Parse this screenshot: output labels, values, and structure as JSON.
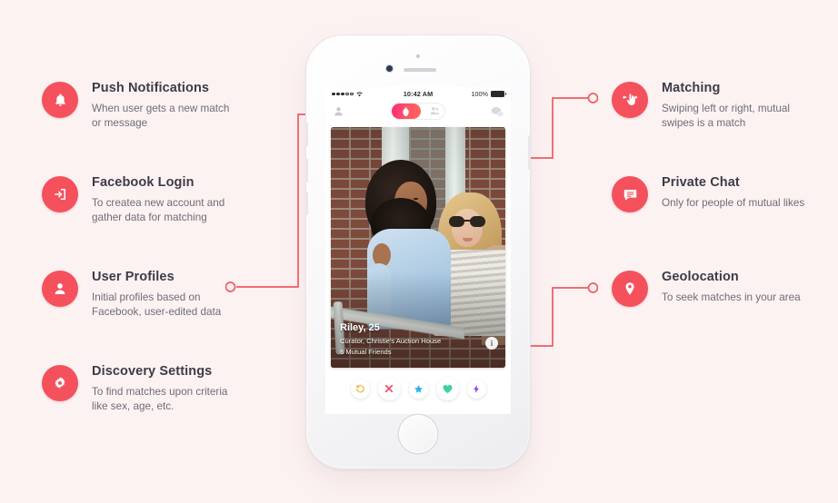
{
  "page": {
    "background_color": "#fdf2f2",
    "accent_color": "#f4515d",
    "connector_color": "#ef5b63"
  },
  "features_left": [
    {
      "icon": "bell-icon",
      "title": "Push Notifications",
      "desc": "When user gets a new match or message"
    },
    {
      "icon": "login-arrow-icon",
      "title": "Facebook Login",
      "desc": "To createa new account and gather data for matching"
    },
    {
      "icon": "user-icon",
      "title": "User Profiles",
      "desc": "Initial profiles based on Facebook, user-edited data"
    },
    {
      "icon": "gear-icon",
      "title": "Discovery Settings",
      "desc": "To find matches upon criteria like sex, age, etc."
    }
  ],
  "features_right": [
    {
      "icon": "swipe-hand-icon",
      "title": "Matching",
      "desc": "Swiping left or right, mutual swipes is a match"
    },
    {
      "icon": "chat-bubble-icon",
      "title": "Private Chat",
      "desc": "Only for people of mutual likes"
    },
    {
      "icon": "map-pin-icon",
      "title": "Geolocation",
      "desc": "To seek matches in your area"
    }
  ],
  "phone": {
    "status_bar": {
      "time": "10:42 AM",
      "battery": "100%",
      "carrier_dots": 5,
      "wifi_icon": "wifi-icon"
    },
    "app_nav": {
      "profile_icon": "profile-silhouette-icon",
      "toggle_active_icon": "flame-icon",
      "toggle_inactive_icon": "people-icon",
      "chat_icon": "chat-bubbles-icon"
    },
    "card": {
      "name": "Riley, 25",
      "occupation": "Curator, Christie's Auction House",
      "mutual_friends": "6 Mutual Friends",
      "info_button_label": "i"
    },
    "actions": [
      {
        "name": "rewind-button",
        "icon": "rewind-icon",
        "color": "#f5b13d"
      },
      {
        "name": "nope-button",
        "icon": "x-icon",
        "color": "#ef4e6e"
      },
      {
        "name": "superlike-button",
        "icon": "star-icon",
        "color": "#2cb4ef"
      },
      {
        "name": "like-button",
        "icon": "heart-icon",
        "color": "#3ad29f"
      },
      {
        "name": "boost-button",
        "icon": "lightning-icon",
        "color": "#8e44e8"
      }
    ]
  }
}
